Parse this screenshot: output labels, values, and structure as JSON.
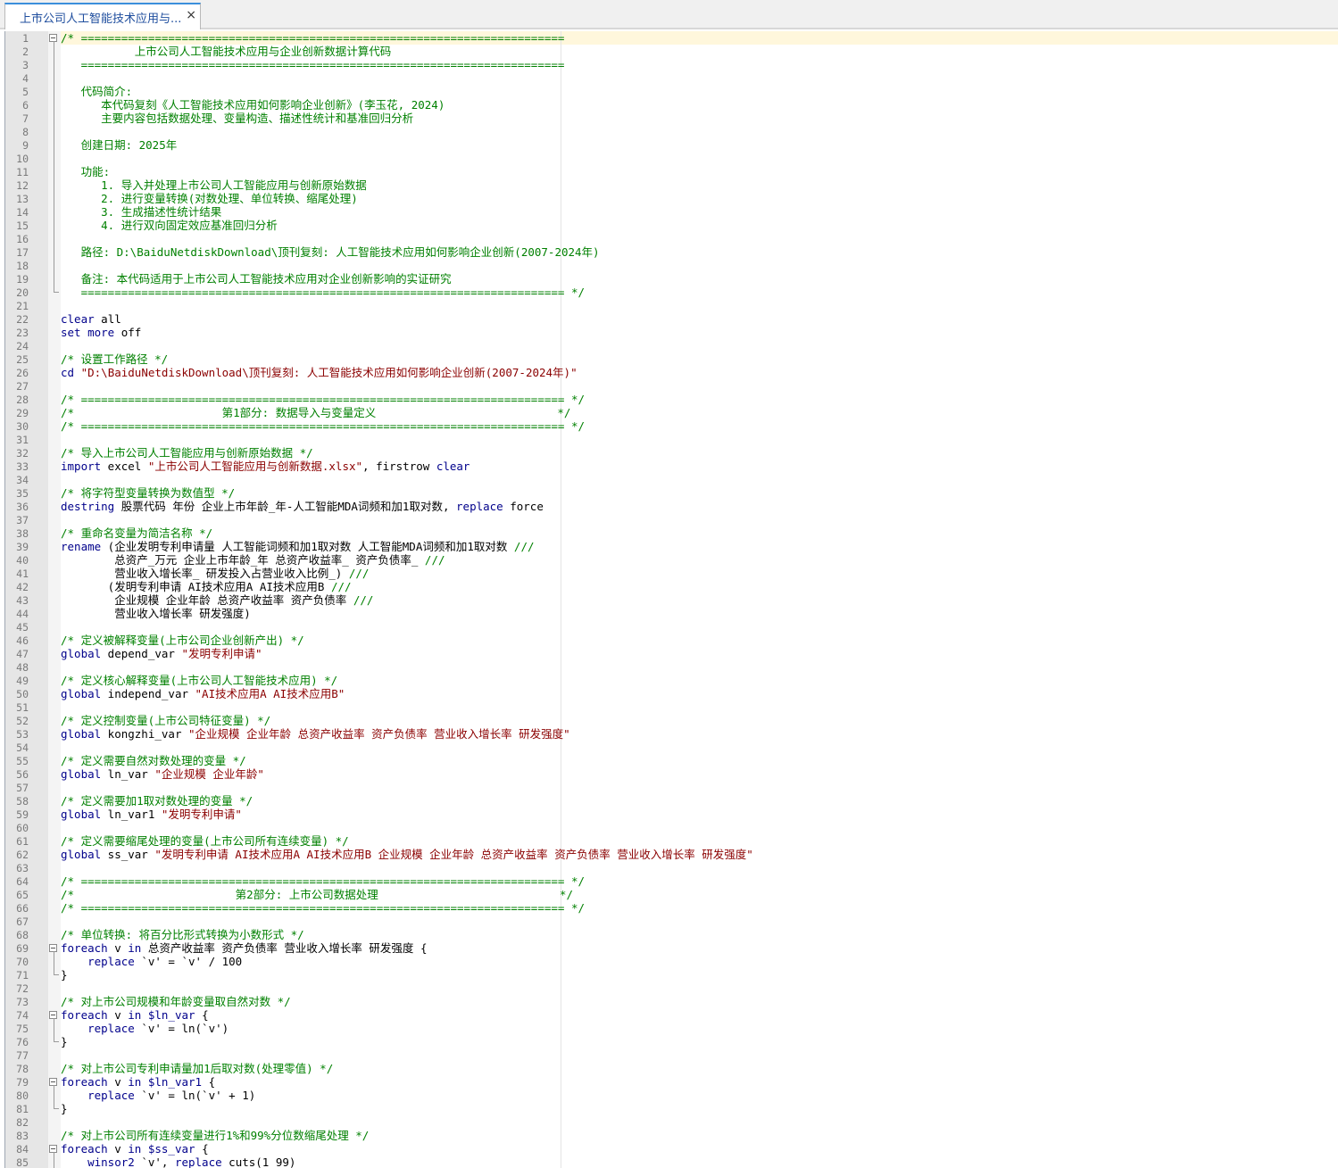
{
  "tab": {
    "title": "上市公司人工智能技术应用与...",
    "close_glyph": "×"
  },
  "colors": {
    "comment": "#008000",
    "keyword": "#00008b",
    "string": "#8b0000",
    "text": "#000000",
    "gutter": "#e6e6e6",
    "current_line": "#fff7dc",
    "tab_accent": "#3b8fdc"
  },
  "icons": [
    "close-icon",
    "fold-minus-icon"
  ],
  "editor": {
    "current_line": 1,
    "lines": [
      {
        "n": "1",
        "fold": "start",
        "segs": [
          [
            "c",
            "/* ========================================================================"
          ]
        ]
      },
      {
        "n": "2",
        "fold": "mid",
        "segs": [
          [
            "c",
            "           上市公司人工智能技术应用与企业创新数据计算代码"
          ]
        ]
      },
      {
        "n": "3",
        "fold": "mid",
        "segs": [
          [
            "c",
            "   ========================================================================"
          ]
        ]
      },
      {
        "n": "4",
        "fold": "mid",
        "segs": []
      },
      {
        "n": "5",
        "fold": "mid",
        "segs": [
          [
            "c",
            "   代码简介:"
          ]
        ]
      },
      {
        "n": "6",
        "fold": "mid",
        "segs": [
          [
            "c",
            "      本代码复刻《人工智能技术应用如何影响企业创新》(李玉花, 2024)"
          ]
        ]
      },
      {
        "n": "7",
        "fold": "mid",
        "segs": [
          [
            "c",
            "      主要内容包括数据处理、变量构造、描述性统计和基准回归分析"
          ]
        ]
      },
      {
        "n": "8",
        "fold": "mid",
        "segs": []
      },
      {
        "n": "9",
        "fold": "mid",
        "segs": [
          [
            "c",
            "   创建日期: 2025年"
          ]
        ]
      },
      {
        "n": "10",
        "fold": "mid",
        "segs": []
      },
      {
        "n": "11",
        "fold": "mid",
        "segs": [
          [
            "c",
            "   功能:"
          ]
        ]
      },
      {
        "n": "12",
        "fold": "mid",
        "segs": [
          [
            "c",
            "      1. 导入并处理上市公司人工智能应用与创新原始数据"
          ]
        ]
      },
      {
        "n": "13",
        "fold": "mid",
        "segs": [
          [
            "c",
            "      2. 进行变量转换(对数处理、单位转换、缩尾处理)"
          ]
        ]
      },
      {
        "n": "14",
        "fold": "mid",
        "segs": [
          [
            "c",
            "      3. 生成描述性统计结果"
          ]
        ]
      },
      {
        "n": "15",
        "fold": "mid",
        "segs": [
          [
            "c",
            "      4. 进行双向固定效应基准回归分析"
          ]
        ]
      },
      {
        "n": "16",
        "fold": "mid",
        "segs": []
      },
      {
        "n": "17",
        "fold": "mid",
        "segs": [
          [
            "c",
            "   路径: D:\\BaiduNetdiskDownload\\顶刊复刻: 人工智能技术应用如何影响企业创新(2007-2024年)"
          ]
        ]
      },
      {
        "n": "18",
        "fold": "mid",
        "segs": []
      },
      {
        "n": "19",
        "fold": "mid",
        "segs": [
          [
            "c",
            "   备注: 本代码适用于上市公司人工智能技术应用对企业创新影响的实证研究"
          ]
        ]
      },
      {
        "n": "20",
        "fold": "end",
        "segs": [
          [
            "c",
            "   ======================================================================== */"
          ]
        ]
      },
      {
        "n": "21",
        "segs": []
      },
      {
        "n": "22",
        "segs": [
          [
            "k",
            "clear"
          ],
          [
            "t",
            " all"
          ]
        ]
      },
      {
        "n": "23",
        "segs": [
          [
            "k",
            "set"
          ],
          [
            "t",
            " "
          ],
          [
            "k",
            "more"
          ],
          [
            "t",
            " off"
          ]
        ]
      },
      {
        "n": "24",
        "segs": []
      },
      {
        "n": "25",
        "segs": [
          [
            "c",
            "/* 设置工作路径 */"
          ]
        ]
      },
      {
        "n": "26",
        "segs": [
          [
            "k",
            "cd"
          ],
          [
            "t",
            " "
          ],
          [
            "s",
            "\"D:\\BaiduNetdiskDownload\\顶刊复刻: 人工智能技术应用如何影响企业创新(2007-2024年)\""
          ]
        ]
      },
      {
        "n": "27",
        "segs": []
      },
      {
        "n": "28",
        "segs": [
          [
            "c",
            "/* ======================================================================== */"
          ]
        ]
      },
      {
        "n": "29",
        "segs": [
          [
            "c",
            "/*                      第1部分: 数据导入与变量定义                           */"
          ]
        ]
      },
      {
        "n": "30",
        "segs": [
          [
            "c",
            "/* ======================================================================== */"
          ]
        ]
      },
      {
        "n": "31",
        "segs": []
      },
      {
        "n": "32",
        "segs": [
          [
            "c",
            "/* 导入上市公司人工智能应用与创新原始数据 */"
          ]
        ]
      },
      {
        "n": "33",
        "segs": [
          [
            "k",
            "import"
          ],
          [
            "t",
            " excel "
          ],
          [
            "s",
            "\"上市公司人工智能应用与创新数据.xlsx\""
          ],
          [
            "t",
            ", firstrow "
          ],
          [
            "k",
            "clear"
          ]
        ]
      },
      {
        "n": "34",
        "segs": []
      },
      {
        "n": "35",
        "segs": [
          [
            "c",
            "/* 将字符型变量转换为数值型 */"
          ]
        ]
      },
      {
        "n": "36",
        "segs": [
          [
            "k",
            "destring"
          ],
          [
            "t",
            " 股票代码 年份 企业上市年龄_年-人工智能MDA词频和加1取对数, "
          ],
          [
            "k",
            "replace"
          ],
          [
            "t",
            " force"
          ]
        ]
      },
      {
        "n": "37",
        "segs": []
      },
      {
        "n": "38",
        "segs": [
          [
            "c",
            "/* 重命名变量为简洁名称 */"
          ]
        ]
      },
      {
        "n": "39",
        "segs": [
          [
            "k",
            "rename"
          ],
          [
            "t",
            " (企业发明专利申请量 人工智能词频和加1取对数 人工智能MDA词频和加1取对数 "
          ],
          [
            "c",
            "///"
          ]
        ]
      },
      {
        "n": "40",
        "segs": [
          [
            "t",
            "        总资产_万元 企业上市年龄_年 总资产收益率_ 资产负债率_ "
          ],
          [
            "c",
            "///"
          ]
        ]
      },
      {
        "n": "41",
        "segs": [
          [
            "t",
            "        营业收入增长率_ 研发投入占营业收入比例_) "
          ],
          [
            "c",
            "///"
          ]
        ]
      },
      {
        "n": "42",
        "segs": [
          [
            "t",
            "       (发明专利申请 AI技术应用A AI技术应用B "
          ],
          [
            "c",
            "///"
          ]
        ]
      },
      {
        "n": "43",
        "segs": [
          [
            "t",
            "        企业规模 企业年龄 总资产收益率 资产负债率 "
          ],
          [
            "c",
            "///"
          ]
        ]
      },
      {
        "n": "44",
        "segs": [
          [
            "t",
            "        营业收入增长率 研发强度)"
          ]
        ]
      },
      {
        "n": "45",
        "segs": []
      },
      {
        "n": "46",
        "segs": [
          [
            "c",
            "/* 定义被解释变量(上市公司企业创新产出) */"
          ]
        ]
      },
      {
        "n": "47",
        "segs": [
          [
            "k",
            "global"
          ],
          [
            "t",
            " depend_var "
          ],
          [
            "s",
            "\"发明专利申请\""
          ]
        ]
      },
      {
        "n": "48",
        "segs": []
      },
      {
        "n": "49",
        "segs": [
          [
            "c",
            "/* 定义核心解释变量(上市公司人工智能技术应用) */"
          ]
        ]
      },
      {
        "n": "50",
        "segs": [
          [
            "k",
            "global"
          ],
          [
            "t",
            " independ_var "
          ],
          [
            "s",
            "\"AI技术应用A AI技术应用B\""
          ]
        ]
      },
      {
        "n": "51",
        "segs": []
      },
      {
        "n": "52",
        "segs": [
          [
            "c",
            "/* 定义控制变量(上市公司特征变量) */"
          ]
        ]
      },
      {
        "n": "53",
        "segs": [
          [
            "k",
            "global"
          ],
          [
            "t",
            " kongzhi_var "
          ],
          [
            "s",
            "\"企业规模 企业年龄 总资产收益率 资产负债率 营业收入增长率 研发强度\""
          ]
        ]
      },
      {
        "n": "54",
        "segs": []
      },
      {
        "n": "55",
        "segs": [
          [
            "c",
            "/* 定义需要自然对数处理的变量 */"
          ]
        ]
      },
      {
        "n": "56",
        "segs": [
          [
            "k",
            "global"
          ],
          [
            "t",
            " ln_var "
          ],
          [
            "s",
            "\"企业规模 企业年龄\""
          ]
        ]
      },
      {
        "n": "57",
        "segs": []
      },
      {
        "n": "58",
        "segs": [
          [
            "c",
            "/* 定义需要加1取对数处理的变量 */"
          ]
        ]
      },
      {
        "n": "59",
        "segs": [
          [
            "k",
            "global"
          ],
          [
            "t",
            " ln_var1 "
          ],
          [
            "s",
            "\"发明专利申请\""
          ]
        ]
      },
      {
        "n": "60",
        "segs": []
      },
      {
        "n": "61",
        "segs": [
          [
            "c",
            "/* 定义需要缩尾处理的变量(上市公司所有连续变量) */"
          ]
        ]
      },
      {
        "n": "62",
        "segs": [
          [
            "k",
            "global"
          ],
          [
            "t",
            " ss_var "
          ],
          [
            "s",
            "\"发明专利申请 AI技术应用A AI技术应用B 企业规模 企业年龄 总资产收益率 资产负债率 营业收入增长率 研发强度\""
          ]
        ]
      },
      {
        "n": "63",
        "segs": []
      },
      {
        "n": "64",
        "segs": [
          [
            "c",
            "/* ======================================================================== */"
          ]
        ]
      },
      {
        "n": "65",
        "segs": [
          [
            "c",
            "/*                        第2部分: 上市公司数据处理                           */"
          ]
        ]
      },
      {
        "n": "66",
        "segs": [
          [
            "c",
            "/* ======================================================================== */"
          ]
        ]
      },
      {
        "n": "67",
        "segs": []
      },
      {
        "n": "68",
        "segs": [
          [
            "c",
            "/* 单位转换: 将百分比形式转换为小数形式 */"
          ]
        ]
      },
      {
        "n": "69",
        "fold": "start",
        "segs": [
          [
            "k",
            "foreach"
          ],
          [
            "t",
            " v "
          ],
          [
            "k",
            "in"
          ],
          [
            "t",
            " 总资产收益率 资产负债率 营业收入增长率 研发强度 {"
          ]
        ]
      },
      {
        "n": "70",
        "fold": "mid",
        "segs": [
          [
            "t",
            "    "
          ],
          [
            "k",
            "replace"
          ],
          [
            "t",
            " `v' = `v' / 100"
          ]
        ]
      },
      {
        "n": "71",
        "fold": "end",
        "segs": [
          [
            "t",
            "}"
          ]
        ]
      },
      {
        "n": "72",
        "segs": []
      },
      {
        "n": "73",
        "segs": [
          [
            "c",
            "/* 对上市公司规模和年龄变量取自然对数 */"
          ]
        ]
      },
      {
        "n": "74",
        "fold": "start",
        "segs": [
          [
            "k",
            "foreach"
          ],
          [
            "t",
            " v "
          ],
          [
            "k",
            "in"
          ],
          [
            "t",
            " "
          ],
          [
            "k",
            "$ln_var"
          ],
          [
            "t",
            " {"
          ]
        ]
      },
      {
        "n": "75",
        "fold": "mid",
        "segs": [
          [
            "t",
            "    "
          ],
          [
            "k",
            "replace"
          ],
          [
            "t",
            " `v' = ln(`v')"
          ]
        ]
      },
      {
        "n": "76",
        "fold": "end",
        "segs": [
          [
            "t",
            "}"
          ]
        ]
      },
      {
        "n": "77",
        "segs": []
      },
      {
        "n": "78",
        "segs": [
          [
            "c",
            "/* 对上市公司专利申请量加1后取对数(处理零值) */"
          ]
        ]
      },
      {
        "n": "79",
        "fold": "start",
        "segs": [
          [
            "k",
            "foreach"
          ],
          [
            "t",
            " v "
          ],
          [
            "k",
            "in"
          ],
          [
            "t",
            " "
          ],
          [
            "k",
            "$ln_var1"
          ],
          [
            "t",
            " {"
          ]
        ]
      },
      {
        "n": "80",
        "fold": "mid",
        "segs": [
          [
            "t",
            "    "
          ],
          [
            "k",
            "replace"
          ],
          [
            "t",
            " `v' = ln(`v' + 1)"
          ]
        ]
      },
      {
        "n": "81",
        "fold": "end",
        "segs": [
          [
            "t",
            "}"
          ]
        ]
      },
      {
        "n": "82",
        "segs": []
      },
      {
        "n": "83",
        "segs": [
          [
            "c",
            "/* 对上市公司所有连续变量进行1%和99%分位数缩尾处理 */"
          ]
        ]
      },
      {
        "n": "84",
        "fold": "start",
        "segs": [
          [
            "k",
            "foreach"
          ],
          [
            "t",
            " v "
          ],
          [
            "k",
            "in"
          ],
          [
            "t",
            " "
          ],
          [
            "k",
            "$ss_var"
          ],
          [
            "t",
            " {"
          ]
        ]
      },
      {
        "n": "85",
        "fold": "mid",
        "segs": [
          [
            "t",
            "    "
          ],
          [
            "k",
            "winsor2"
          ],
          [
            "t",
            " `v', "
          ],
          [
            "k",
            "replace"
          ],
          [
            "t",
            " cuts(1 99)"
          ]
        ]
      }
    ]
  }
}
